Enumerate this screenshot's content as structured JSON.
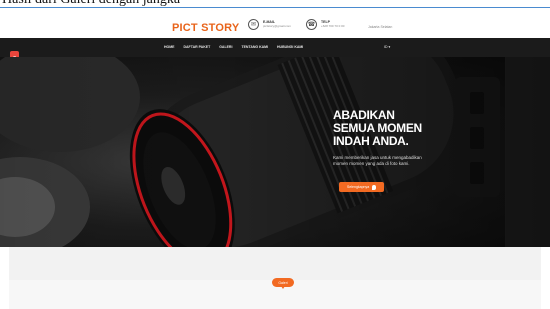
{
  "caption": {
    "text": "Hasil dari Galeri dengan jangka"
  },
  "header": {
    "brand": "PICT STORY",
    "email_label": "E-MAIL",
    "email_value": "pictstory@gmail.com",
    "phone_label": "TELP",
    "phone_value": "+628 700 70 0 00",
    "note": "Jakarta Selatan"
  },
  "nav": {
    "items": [
      "HOME",
      "DAFTAR PAKET",
      "GALERI",
      "TENTANG KAMI",
      "HUBUNGI KAMI"
    ],
    "language": "ID ▾"
  },
  "hero": {
    "title_line1": "ABADIKAN",
    "title_line2": "SEMUA MOMEN",
    "title_line3": "INDAH ANDA.",
    "description": "Kami memberikan jasa untuk mengabadikan momen momen yang ada di foto kami.",
    "button_label": "Selengkapnya"
  },
  "section": {
    "badge_label": "Galeri"
  },
  "colors": {
    "accent": "#f26a22",
    "brand": "#e8641b",
    "nav_bg": "#1b1b1b",
    "lens_ring": "#c4161c"
  }
}
